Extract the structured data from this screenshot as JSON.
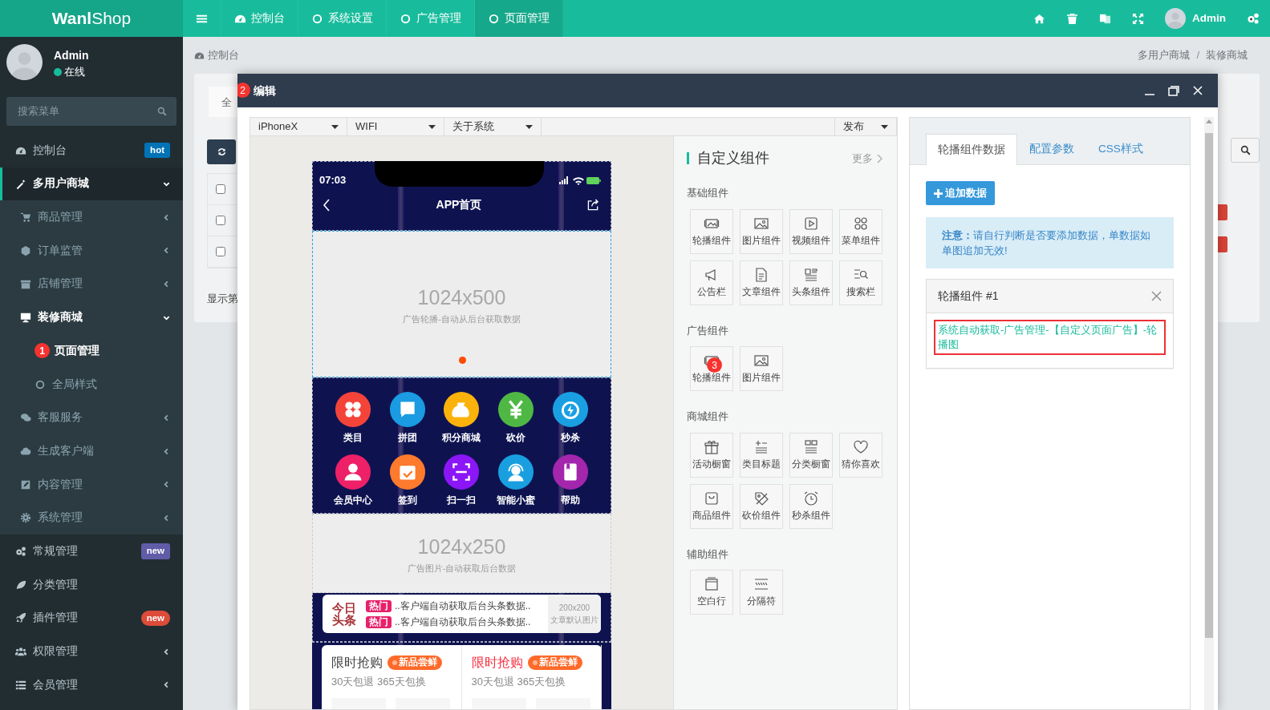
{
  "topbar": {
    "logo": "**Wanl**Shop",
    "tabs": [
      {
        "label": "控制台",
        "selected": false
      },
      {
        "label": "系统设置",
        "selected": false
      },
      {
        "label": "广告管理",
        "selected": false
      },
      {
        "label": "页面管理",
        "selected": true
      }
    ],
    "user": "Admin"
  },
  "sidebar": {
    "user": {
      "name": "Admin",
      "status": "在线",
      "online": true
    },
    "search": {
      "placeholder": "搜索菜单"
    },
    "items": [
      {
        "label": "控制台",
        "selected": false,
        "badge": {
          "text": "hot",
          "color": "#0073b7"
        }
      },
      {
        "label": "多用户商城",
        "selected": true,
        "expanded": true,
        "children": [
          {
            "label": "商品管理",
            "selected": false,
            "expanded": false
          },
          {
            "label": "订单监管",
            "selected": false,
            "expanded": false
          },
          {
            "label": "店铺管理",
            "selected": false,
            "expanded": false
          },
          {
            "label": "装修商城",
            "selected": true,
            "expanded": true,
            "children": [
              {
                "label": "页面管理",
                "selected": true,
                "marker": "1"
              },
              {
                "label": "全局样式",
                "selected": false
              }
            ]
          },
          {
            "label": "客服服务",
            "selected": false,
            "expanded": false
          },
          {
            "label": "生成客户端",
            "selected": false,
            "expanded": false
          },
          {
            "label": "内容管理",
            "selected": false,
            "expanded": false
          },
          {
            "label": "系统管理",
            "selected": false,
            "expanded": false
          }
        ]
      },
      {
        "label": "常规管理",
        "selected": false,
        "badge": {
          "text": "new",
          "color": "#605ca8"
        }
      },
      {
        "label": "分类管理",
        "selected": false
      },
      {
        "label": "插件管理",
        "selected": false,
        "badge": {
          "text": "new",
          "color": "#dd4b39"
        }
      },
      {
        "label": "权限管理",
        "selected": false,
        "expanded": false
      },
      {
        "label": "会员管理",
        "selected": false,
        "expanded": false
      }
    ]
  },
  "breadcrumb": {
    "home": "控制台",
    "trail": [
      "多用户商城",
      "装修商城"
    ],
    "separator": "/"
  },
  "background_panel": {
    "tab": "全",
    "rows": [
      {
        "checked": false
      },
      {
        "checked": false
      },
      {
        "checked": false
      }
    ],
    "footer": "显示第"
  },
  "modal": {
    "marker": "2",
    "title": "编辑",
    "toolbar": {
      "selects": [
        "iPhoneX",
        "WIFI",
        "关于系统"
      ],
      "publish": "发布"
    },
    "phone": {
      "time": "07:03",
      "title": "APP首页",
      "banner": {
        "size": "1024x500",
        "caption": "广告轮播-自动从后台获取数据"
      },
      "shortcuts": [
        {
          "label": "类目",
          "color": "#f4443a"
        },
        {
          "label": "拼团",
          "color": "#1a9be2"
        },
        {
          "label": "积分商城",
          "color": "#fbb20a"
        },
        {
          "label": "砍价",
          "color": "#4fb844"
        },
        {
          "label": "秒杀",
          "color": "#1a9fe2"
        },
        {
          "label": "会员中心",
          "color": "#ee2068"
        },
        {
          "label": "签到",
          "color": "#fe7a2c"
        },
        {
          "label": "扫一扫",
          "color": "#8b16f8"
        },
        {
          "label": "智能小蜜",
          "color": "#199fe0"
        },
        {
          "label": "帮助",
          "color": "#a326ad"
        }
      ],
      "ad": {
        "size": "1024x250",
        "caption": "广告图片-自动获取后台数据"
      },
      "headline": {
        "logo": [
          "今日",
          "头条"
        ],
        "items": [
          {
            "tag": "热门",
            "text": "..客户端自动获取后台头条数据.."
          },
          {
            "tag": "热门",
            "text": "..客户端自动获取后台头条数据.."
          }
        ],
        "thumb": {
          "size": "200x200",
          "caption": "文章默认图片"
        }
      },
      "flash_sales": [
        {
          "title": "限时抢购",
          "badge": "新品尝鲜",
          "subtitle": "30天包退 365天包换",
          "highlight": false
        },
        {
          "title": "限时抢购",
          "badge": "新品尝鲜",
          "subtitle": "30天包退 365天包换",
          "highlight": true
        }
      ]
    },
    "components": {
      "title": "自定义组件",
      "more": "更多",
      "sections": [
        {
          "title": "基础组件",
          "items": [
            {
              "label": "轮播组件"
            },
            {
              "label": "图片组件"
            },
            {
              "label": "视频组件"
            },
            {
              "label": "菜单组件"
            },
            {
              "label": "公告栏"
            },
            {
              "label": "文章组件"
            },
            {
              "label": "头条组件"
            },
            {
              "label": "搜索栏"
            }
          ]
        },
        {
          "title": "广告组件",
          "items": [
            {
              "label": "轮播组件",
              "marker": "3"
            },
            {
              "label": "图片组件"
            }
          ]
        },
        {
          "title": "商城组件",
          "items": [
            {
              "label": "活动橱窗"
            },
            {
              "label": "类目标题"
            },
            {
              "label": "分类橱窗"
            },
            {
              "label": "猜你喜欢"
            },
            {
              "label": "商品组件"
            },
            {
              "label": "砍价组件"
            },
            {
              "label": "秒杀组件"
            }
          ]
        },
        {
          "title": "辅助组件",
          "items": [
            {
              "label": "空白行"
            },
            {
              "label": "分隔符"
            }
          ]
        }
      ]
    },
    "editor": {
      "tabs": [
        {
          "label": "轮播组件数据",
          "selected": true
        },
        {
          "label": "配置参数",
          "selected": false
        },
        {
          "label": "CSS样式",
          "selected": false
        }
      ],
      "add_button": "追加数据",
      "notice": "**注意：**请自行判断是否要添加数据，单数据如单图追加无效!",
      "item": {
        "title": "轮播组件 #1",
        "source": "系统自动获取-广告管理-【自定义页面广告】-轮播图",
        "highlighted": true
      }
    }
  }
}
